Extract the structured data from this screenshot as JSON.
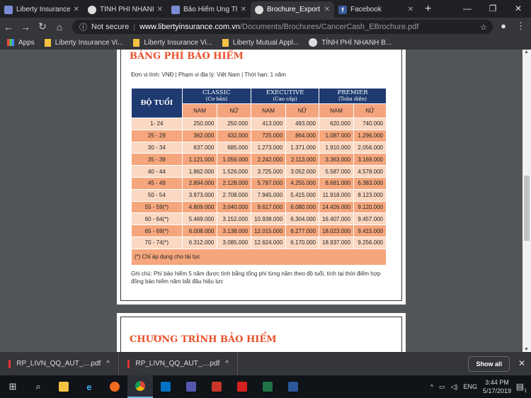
{
  "browser": {
    "tabs": [
      {
        "title": "Liberty Insurance",
        "icon": "liberty-icon",
        "active": false
      },
      {
        "title": "TÍNH PHÍ NHANH",
        "icon": "globe-icon",
        "active": false
      },
      {
        "title": "Bảo Hiểm Ung Th",
        "icon": "liberty-icon",
        "active": false
      },
      {
        "title": "Brochure_Export",
        "icon": "globe-icon",
        "active": true
      },
      {
        "title": "Facebook",
        "icon": "facebook-icon",
        "active": false
      }
    ],
    "security": "Not secure",
    "url_host": "www.libertyinsurance.com.vn",
    "url_path": "/Documents/Brochures/CancerCash_EBrochure.pdf",
    "bookmarks": [
      {
        "label": "Apps",
        "icon": "apps-icon"
      },
      {
        "label": "Liberty Insurance Vi...",
        "icon": "folder-icon"
      },
      {
        "label": "Liberty Insurance Vi...",
        "icon": "folder-icon"
      },
      {
        "label": "Liberty Mutual Appl...",
        "icon": "folder-icon"
      },
      {
        "label": "TÍNH PHÍ NHANH B...",
        "icon": "globe-icon"
      }
    ]
  },
  "doc": {
    "title": "BẢNG PHÍ BẢO HIỂM",
    "subtitle": "Đơn vị tính: VNĐ | Phạm vi địa lý: Việt Nam | Thời hạn: 1 năm",
    "age_header": "ĐỘ TUỔI",
    "plans": [
      {
        "name": "CLASSIC",
        "sub": "(Cơ bản)"
      },
      {
        "name": "EXECUTIVE",
        "sub": "(Cao cấp)"
      },
      {
        "name": "PREMIER",
        "sub": "(Toàn diện)"
      }
    ],
    "male": "NAM",
    "female": "NỮ",
    "rows": [
      [
        "1- 24",
        "250.000",
        "250.000",
        "413.000",
        "493.000",
        "620.000",
        "740.000"
      ],
      [
        "25 - 29",
        "362.000",
        "432.000",
        "725.000",
        "864.000",
        "1.087.000",
        "1.296.000"
      ],
      [
        "30 - 34",
        "637.000",
        "685.000",
        "1.273.000",
        "1.371.000",
        "1.910.000",
        "2.056.000"
      ],
      [
        "35 - 39",
        "1.121.000",
        "1.056.000",
        "2.242.000",
        "2.113.000",
        "3.363.000",
        "3.169.000"
      ],
      [
        "40 - 44",
        "1.862.000",
        "1.526.000",
        "3.725.000",
        "3.052.000",
        "5.587.000",
        "4.578.000"
      ],
      [
        "45 - 49",
        "2.894.000",
        "2.128.000",
        "5.787.000",
        "4.255.000",
        "8.681.000",
        "6.383.000"
      ],
      [
        "50 - 54",
        "3.973.000",
        "2.708.000",
        "7.945.000",
        "5.415.000",
        "11.918.000",
        "8.123.000"
      ],
      [
        "55 - 59(*)",
        "4.809.000",
        "3.040.000",
        "9.617.000",
        "6.080.000",
        "14.426.000",
        "9.120.000"
      ],
      [
        "60 - 64(*)",
        "5.469.000",
        "3.152.000",
        "10.938.000",
        "6.304.000",
        "16.407.000",
        "9.457.000"
      ],
      [
        "65 - 69(*)",
        "6.008.000",
        "3.138.000",
        "12.015.000",
        "6.277.000",
        "18.023.000",
        "9.415.000"
      ],
      [
        "70 - 74(*)",
        "6.312.000",
        "3.085.000",
        "12.624.000",
        "6.170.000",
        "18.937.000",
        "9.256.000"
      ]
    ],
    "footnote": "(*) Chỉ áp dụng cho tái tục",
    "note": "Ghi chú: Phí bảo hiểm 5 năm được tính bằng tổng phí từng năm theo độ tuổi, tính tại thời điểm hợp đồng bảo hiểm năm bắt đầu hiệu lực",
    "page2_title": "CHƯƠNG TRÌNH BẢO HIỂM",
    "colors": {
      "header_navy": "#1e3a70",
      "salmon": "#f5a67c",
      "light": "#fbd8c2",
      "title_orange": "#e8502a"
    }
  },
  "downloads": {
    "items": [
      "RP_LIVN_QQ_AUT_....pdf",
      "RP_LIVN_QQ_AUT_....pdf"
    ],
    "show_all": "Show all"
  },
  "taskbar": {
    "lang": "ENG",
    "time": "3:44 PM",
    "date": "5/17/2019",
    "notifications": "1"
  }
}
